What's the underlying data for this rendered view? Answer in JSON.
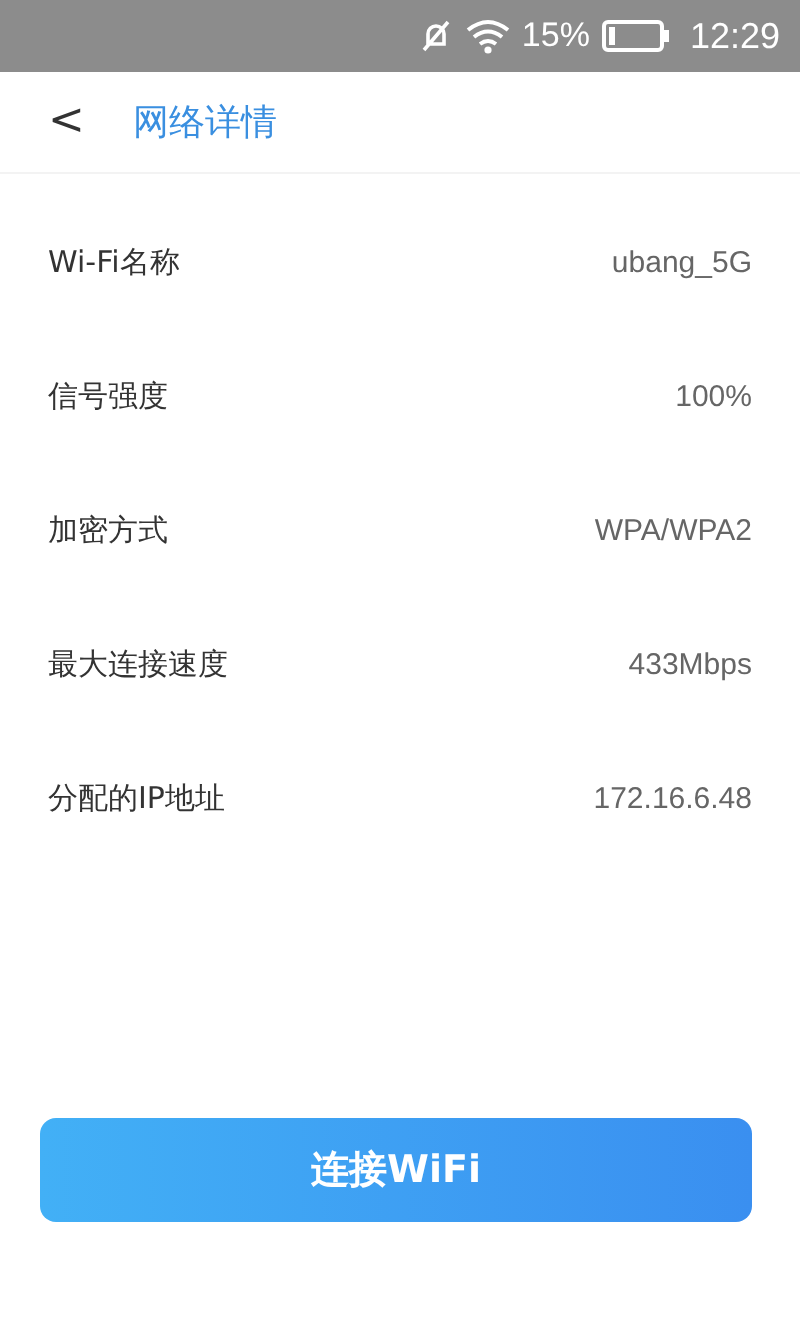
{
  "status_bar": {
    "battery": "15%",
    "time": "12:29"
  },
  "header": {
    "back": "<",
    "title": "网络详情"
  },
  "details": [
    {
      "label": "Wi-Fi名称",
      "value": "ubang_5G"
    },
    {
      "label": "信号强度",
      "value": "100%"
    },
    {
      "label": "加密方式",
      "value": "WPA/WPA2"
    },
    {
      "label": "最大连接速度",
      "value": "433Mbps"
    },
    {
      "label": "分配的IP地址",
      "value": "172.16.6.48"
    }
  ],
  "connect_button": "连接WiFi"
}
